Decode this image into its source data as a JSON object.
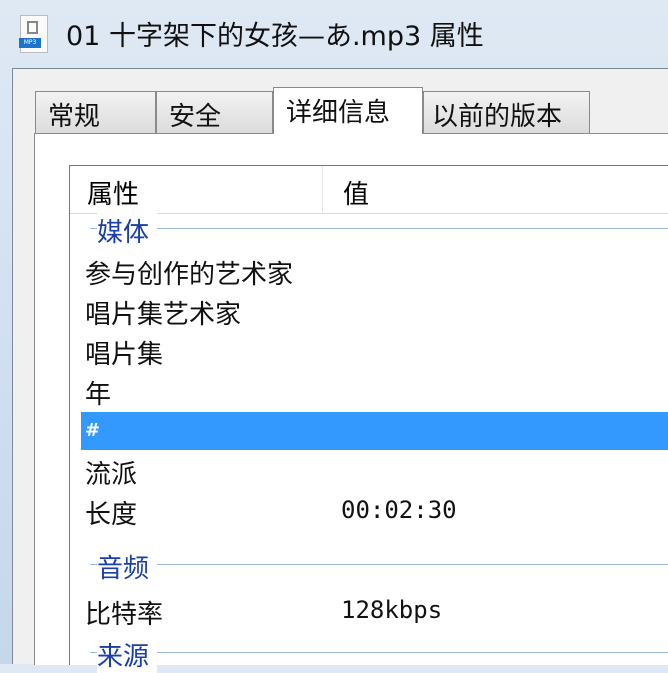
{
  "window": {
    "title": "01 十字架下的女孩—あ.mp3 属性",
    "file_badge": "MP3"
  },
  "tabs": [
    {
      "label": "常规"
    },
    {
      "label": "安全"
    },
    {
      "label": "详细信息",
      "active": true
    },
    {
      "label": "以前的版本"
    }
  ],
  "list": {
    "headers": {
      "property": "属性",
      "value": "值"
    },
    "groups": [
      {
        "label": "媒体"
      },
      {
        "label": "音频"
      },
      {
        "label": "来源"
      }
    ],
    "rows": [
      {
        "key": "参与创作的艺术家",
        "value": ""
      },
      {
        "key": "唱片集艺术家",
        "value": ""
      },
      {
        "key": "唱片集",
        "value": ""
      },
      {
        "key": "年",
        "value": ""
      },
      {
        "key": "#",
        "value": "",
        "selected": true
      },
      {
        "key": "流派",
        "value": ""
      },
      {
        "key": "长度",
        "value": "00:02:30"
      },
      {
        "key": "比特率",
        "value": "128kbps"
      }
    ]
  },
  "colors": {
    "selection": "#3399ff",
    "group": "#1a3fa8"
  }
}
